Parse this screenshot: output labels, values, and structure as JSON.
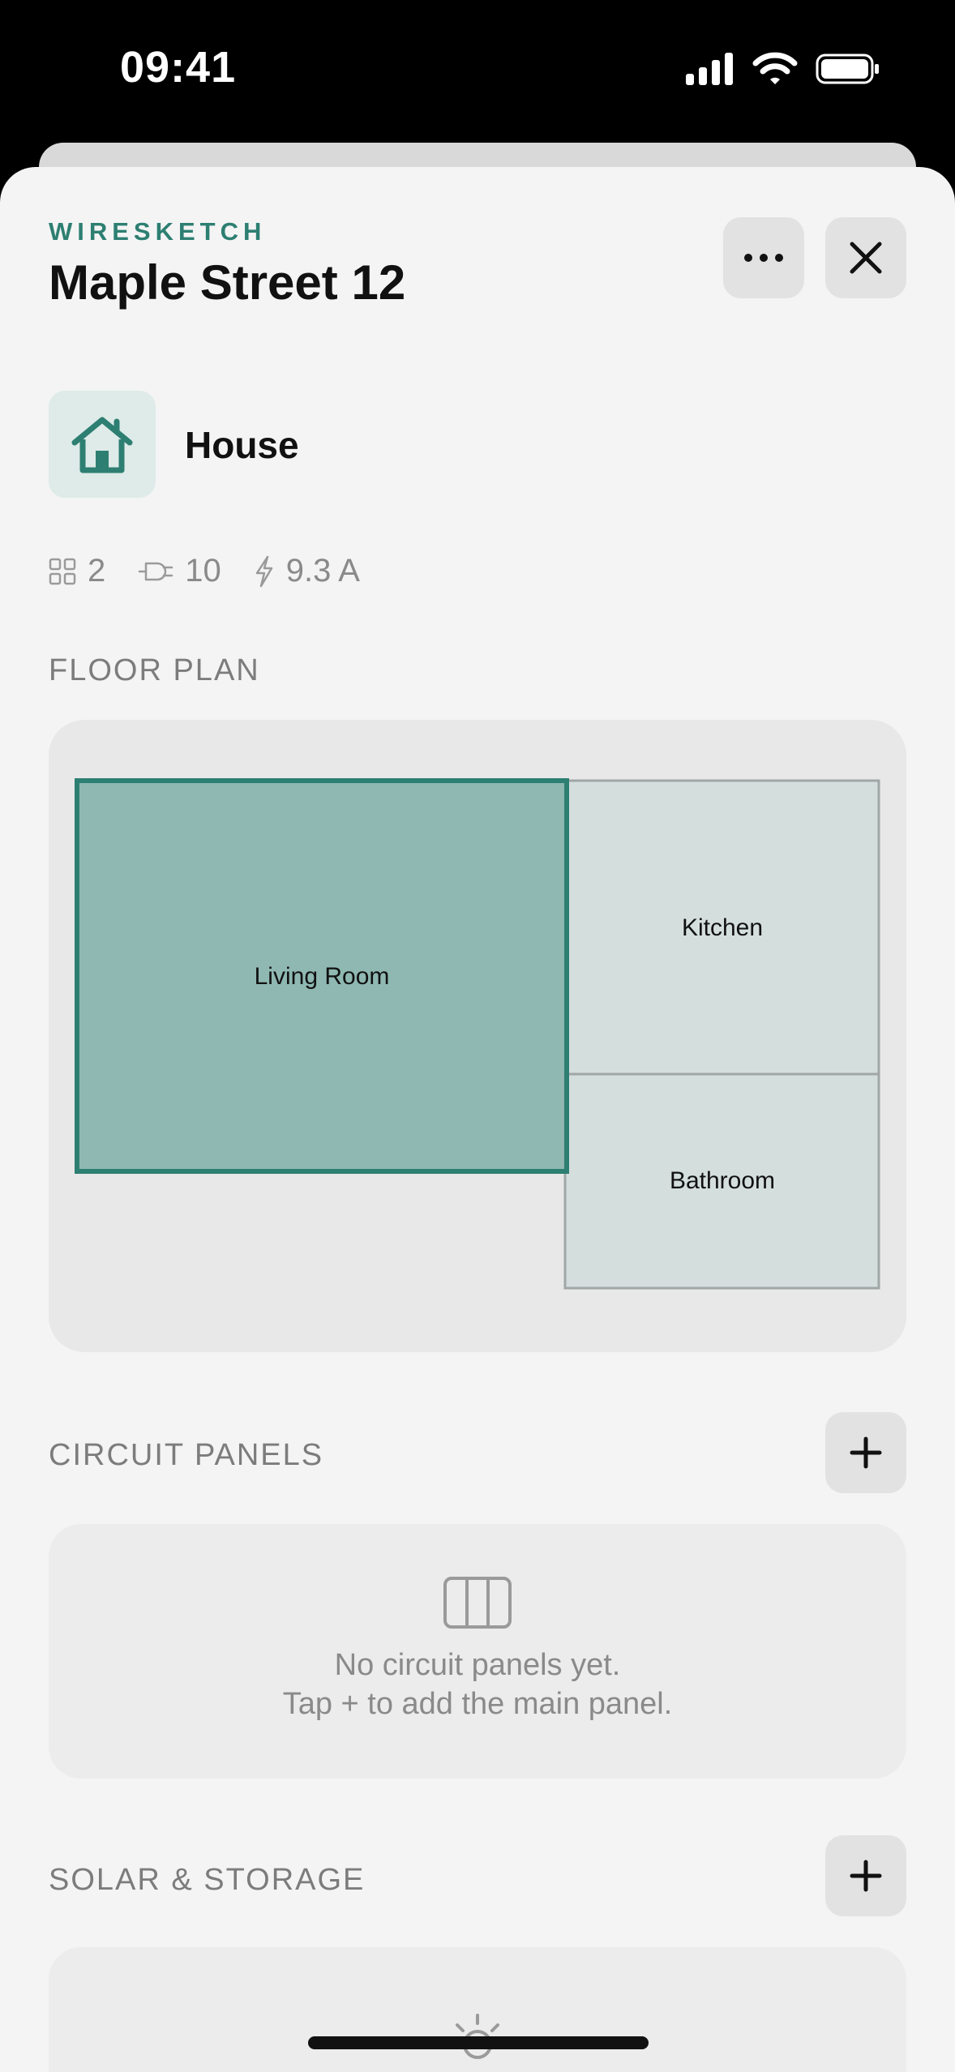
{
  "status": {
    "time": "09:41"
  },
  "header": {
    "brand": "WIRESKETCH",
    "title": "Maple Street 12"
  },
  "building": {
    "type": "House",
    "icon": "house-icon"
  },
  "stats": {
    "rooms": "2",
    "outlets": "10",
    "load": "9.3 A"
  },
  "floor_plan": {
    "section_title": "FLOOR PLAN",
    "rooms": [
      {
        "name": "Living Room",
        "selected": true
      },
      {
        "name": "Kitchen",
        "selected": false
      },
      {
        "name": "Bathroom",
        "selected": false
      }
    ]
  },
  "circuit_panels": {
    "section_title": "CIRCUIT PANELS",
    "empty_line1": "No circuit panels yet.",
    "empty_line2": "Tap + to add the main panel."
  },
  "solar_storage": {
    "section_title": "SOLAR & STORAGE"
  },
  "colors": {
    "accent": "#2d7f72",
    "selected_fill": "#8fb8b2",
    "room_fill": "#d4dedd",
    "background": "#f4f4f4"
  }
}
